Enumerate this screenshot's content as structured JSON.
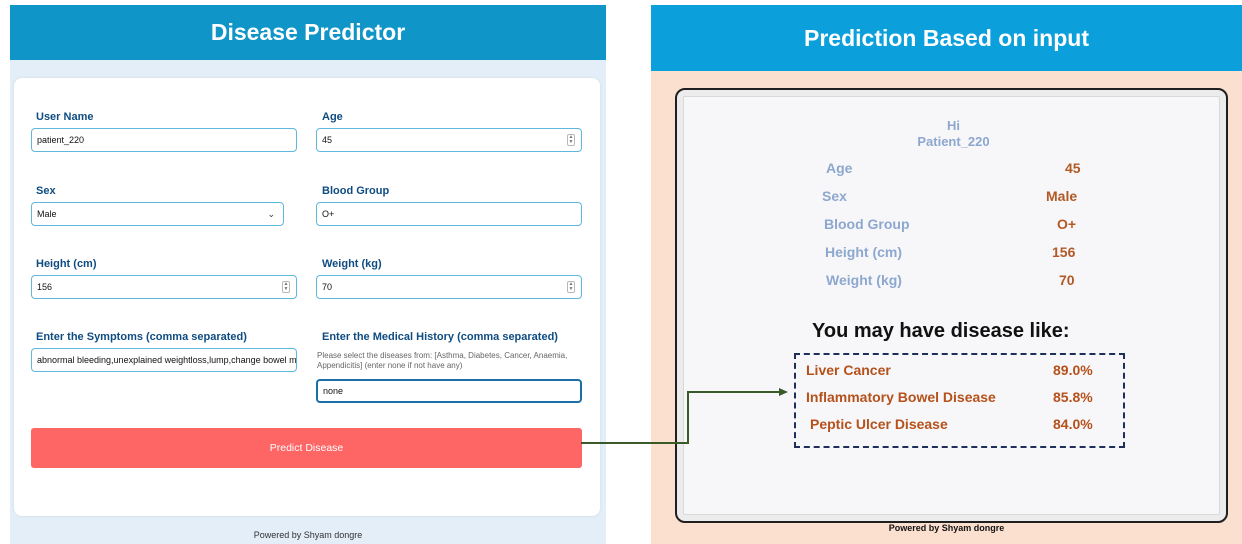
{
  "left": {
    "title": "Disease Predictor",
    "fields": {
      "user_name": {
        "label": "User Name",
        "value": "patient_220"
      },
      "age": {
        "label": "Age",
        "value": "45"
      },
      "sex": {
        "label": "Sex",
        "value": "Male"
      },
      "blood_group": {
        "label": "Blood Group",
        "value": "O+"
      },
      "height": {
        "label": "Height (cm)",
        "value": "156"
      },
      "weight": {
        "label": "Weight (kg)",
        "value": "70"
      },
      "symptoms": {
        "label": "Enter the Symptoms (comma separated)",
        "value": "abnormal bleeding,unexplained weightloss,lump,change bowel m"
      },
      "history": {
        "label": "Enter the Medical History (comma separated)",
        "helper_line1": "Please select the diseases from: [Asthma, Diabetes, Cancer, Anaemia,",
        "helper_line2": "Appendicitis] (enter none if not have any)",
        "value": "none"
      }
    },
    "predict_button": "Predict Disease",
    "footer": "Powered by Shyam dongre"
  },
  "right": {
    "title": "Prediction Based on input",
    "greeting": "Hi",
    "patient": "Patient_220",
    "info": [
      {
        "label": "Age",
        "value": "45"
      },
      {
        "label": "Sex",
        "value": "Male"
      },
      {
        "label": "Blood Group",
        "value": "O+"
      },
      {
        "label": "Height (cm)",
        "value": "156"
      },
      {
        "label": "Weight (kg)",
        "value": "70"
      }
    ],
    "heading": "You may have disease like:",
    "diseases": [
      {
        "name": "Liver Cancer",
        "pct": "89.0%"
      },
      {
        "name": "Inflammatory Bowel Disease",
        "pct": "85.8%"
      },
      {
        "name": "Peptic Ulcer Disease",
        "pct": "84.0%"
      }
    ],
    "footer": "Powered by Shyam dongre"
  },
  "colors": {
    "left_header": "#0f95c8",
    "right_header": "#0b9fdb",
    "button": "#fe6565",
    "connector": "#3b5a2a"
  }
}
